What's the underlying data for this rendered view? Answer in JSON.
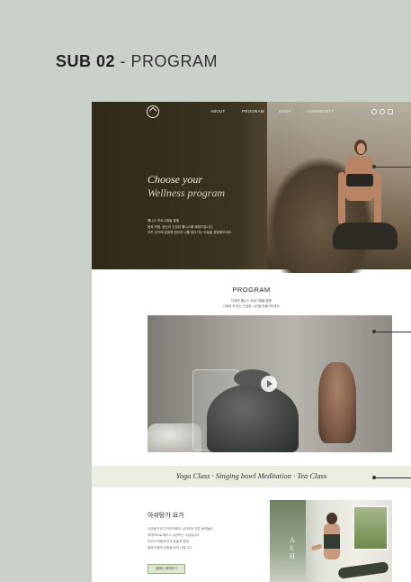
{
  "page_heading": {
    "bold": "SUB 02",
    "sep": " - ",
    "light": "PROGRAM"
  },
  "nav": {
    "items": [
      "ABOUT",
      "PROGRAM",
      "SHOP",
      "COMMUNITY"
    ]
  },
  "hero": {
    "title": "Choose your",
    "subtitle": "Wellness program",
    "text": [
      "웰니스 프로그램을 통해",
      "몸과 마음, 정신이 건강한 웰니스를 채워드립니다.",
      "모든 감각에 집중해 편안히 나를 찾아가는 오늘을 경험해보세요."
    ]
  },
  "program": {
    "title": "PROGRAM",
    "text": [
      "다양한 웰니스 프로그램을 통해",
      "나에게 꼭 맞는 건강한 시간을 만들어보세요."
    ]
  },
  "band": {
    "text": "Yoga Class · Singing bowl Meditation · Tea Class"
  },
  "yoga": {
    "title": "아쉬탕가 요가",
    "text": [
      "아쉬탕가 요가 프라이머리 시리즈의 기본 동작들로",
      "체계적으로 배우고 수련하는 수업입니다.",
      "자신의 리듬에 맞게 호흡과 함께",
      "몸과 마음의 균형을 찾아 나갑니다."
    ],
    "button": "클래스 예약하기",
    "image_letters": "A\nS\nH"
  }
}
